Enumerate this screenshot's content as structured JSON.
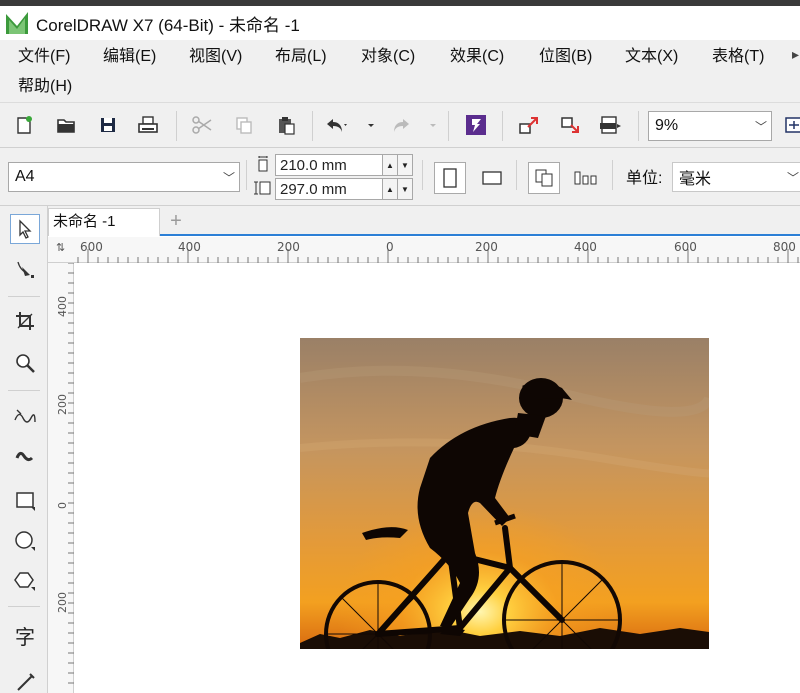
{
  "window": {
    "title": "CorelDRAW X7 (64-Bit) - 未命名 -1"
  },
  "menubar": {
    "items": [
      {
        "label": "文件(F)"
      },
      {
        "label": "编辑(E)"
      },
      {
        "label": "视图(V)"
      },
      {
        "label": "布局(L)"
      },
      {
        "label": "对象(C)"
      },
      {
        "label": "效果(C)"
      },
      {
        "label": "位图(B)"
      },
      {
        "label": "文本(X)"
      },
      {
        "label": "表格(T)"
      },
      {
        "label": "帮助(H)"
      }
    ]
  },
  "toolbar": {
    "zoom_value": "9%",
    "icons": [
      "new-doc-icon",
      "open-icon",
      "save-icon",
      "print-icon",
      "cut-icon",
      "copy-icon",
      "paste-icon",
      "undo-icon",
      "redo-icon",
      "corel-connect-icon",
      "import-icon",
      "export-icon",
      "publish-pdf-icon"
    ]
  },
  "property_bar": {
    "page_size": "A4",
    "width": "210.0 mm",
    "height": "297.0 mm",
    "unit_label": "单位:",
    "unit_value": "毫米"
  },
  "document_tab": {
    "label": "未命名 -1",
    "add_label": "+"
  },
  "ruler": {
    "corner_label": "⇅",
    "h_labels": [
      "600",
      "400",
      "200",
      "0",
      "200",
      "400",
      "600",
      "800"
    ],
    "v_labels": [
      "400",
      "200",
      "0",
      "200"
    ]
  },
  "colors": {
    "chrome_bg": "#f0f0f0",
    "accent_blue": "#2c7fd6",
    "logo_green": "#3c9a3c"
  }
}
